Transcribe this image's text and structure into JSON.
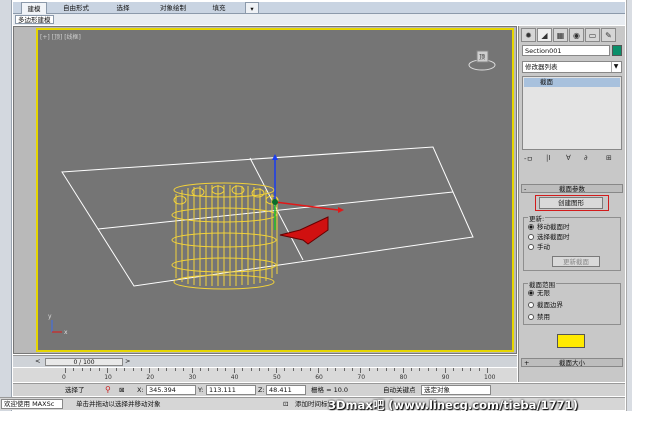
{
  "menubar": {
    "tabs": [
      {
        "label": "建模",
        "active": true
      },
      {
        "label": "自由形式",
        "active": false
      },
      {
        "label": "选择",
        "active": false
      },
      {
        "label": "对象绘制",
        "active": false
      },
      {
        "label": "填充",
        "active": false
      }
    ],
    "dropdown_label": "▾"
  },
  "subbar": {
    "label": "多边形建模"
  },
  "viewport": {
    "label": "[+] [顶] [线框]",
    "border_color": "#e6d600",
    "background": "#757575",
    "gizmo_label": "顶"
  },
  "command_panel": {
    "tabs": [
      "create-icon",
      "modify-icon",
      "hierarchy-icon",
      "motion-icon",
      "display-icon",
      "utilities-icon"
    ],
    "object_name": "Section001",
    "object_color": "#0a8f6a",
    "modifier_list": "修改器列表",
    "stack_item": "截面",
    "stack_tools": [
      "-ㅁ",
      "|I",
      "∀",
      "∂",
      "⊞"
    ],
    "section_params_title": "截面参数",
    "create_shape_button": "创建图形",
    "update_group": {
      "title": "更新:",
      "options": [
        "移动截面时",
        "选择截面时",
        "手动"
      ],
      "selected": 0,
      "update_button": "更新截面"
    },
    "range_group": {
      "title": "截面范围",
      "options": [
        "无限",
        "截面边界",
        "禁用"
      ],
      "selected": 0
    },
    "swatch_color": "#ffea00",
    "section_size_title": "截面大小"
  },
  "timeline": {
    "slider_label": "0 / 100",
    "ticks": [
      "0",
      "10",
      "20",
      "30",
      "40",
      "50",
      "60",
      "70",
      "80",
      "90",
      "100"
    ]
  },
  "status": {
    "selected_label": "选择了",
    "x_label": "X:",
    "x_value": "345.394",
    "y_label": "Y:",
    "y_value": "113.111",
    "z_label": "Z:",
    "z_value": "48.411",
    "grid_label": "栅格 = 10.0",
    "autokey_label": "自动关键点",
    "select_object": "选定对象",
    "welcome": "欢迎使用 MAXSc",
    "hint": "单击并拖动以选择并移动对象",
    "add_time_tag": "添加时间标记",
    "set_key": "设置关键点",
    "key_filter": "关键点过滤"
  },
  "watermark": "3Dmax吧 (www.linecg.com/tieba/1771)"
}
